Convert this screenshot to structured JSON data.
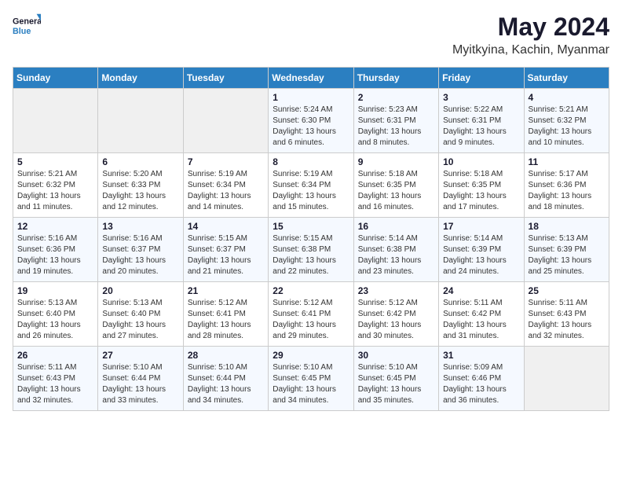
{
  "logo": {
    "line1": "General",
    "line2": "Blue"
  },
  "title": "May 2024",
  "subtitle": "Myitkyina, Kachin, Myanmar",
  "headers": [
    "Sunday",
    "Monday",
    "Tuesday",
    "Wednesday",
    "Thursday",
    "Friday",
    "Saturday"
  ],
  "weeks": [
    [
      {
        "day": "",
        "info": ""
      },
      {
        "day": "",
        "info": ""
      },
      {
        "day": "",
        "info": ""
      },
      {
        "day": "1",
        "info": "Sunrise: 5:24 AM\nSunset: 6:30 PM\nDaylight: 13 hours\nand 6 minutes."
      },
      {
        "day": "2",
        "info": "Sunrise: 5:23 AM\nSunset: 6:31 PM\nDaylight: 13 hours\nand 8 minutes."
      },
      {
        "day": "3",
        "info": "Sunrise: 5:22 AM\nSunset: 6:31 PM\nDaylight: 13 hours\nand 9 minutes."
      },
      {
        "day": "4",
        "info": "Sunrise: 5:21 AM\nSunset: 6:32 PM\nDaylight: 13 hours\nand 10 minutes."
      }
    ],
    [
      {
        "day": "5",
        "info": "Sunrise: 5:21 AM\nSunset: 6:32 PM\nDaylight: 13 hours\nand 11 minutes."
      },
      {
        "day": "6",
        "info": "Sunrise: 5:20 AM\nSunset: 6:33 PM\nDaylight: 13 hours\nand 12 minutes."
      },
      {
        "day": "7",
        "info": "Sunrise: 5:19 AM\nSunset: 6:34 PM\nDaylight: 13 hours\nand 14 minutes."
      },
      {
        "day": "8",
        "info": "Sunrise: 5:19 AM\nSunset: 6:34 PM\nDaylight: 13 hours\nand 15 minutes."
      },
      {
        "day": "9",
        "info": "Sunrise: 5:18 AM\nSunset: 6:35 PM\nDaylight: 13 hours\nand 16 minutes."
      },
      {
        "day": "10",
        "info": "Sunrise: 5:18 AM\nSunset: 6:35 PM\nDaylight: 13 hours\nand 17 minutes."
      },
      {
        "day": "11",
        "info": "Sunrise: 5:17 AM\nSunset: 6:36 PM\nDaylight: 13 hours\nand 18 minutes."
      }
    ],
    [
      {
        "day": "12",
        "info": "Sunrise: 5:16 AM\nSunset: 6:36 PM\nDaylight: 13 hours\nand 19 minutes."
      },
      {
        "day": "13",
        "info": "Sunrise: 5:16 AM\nSunset: 6:37 PM\nDaylight: 13 hours\nand 20 minutes."
      },
      {
        "day": "14",
        "info": "Sunrise: 5:15 AM\nSunset: 6:37 PM\nDaylight: 13 hours\nand 21 minutes."
      },
      {
        "day": "15",
        "info": "Sunrise: 5:15 AM\nSunset: 6:38 PM\nDaylight: 13 hours\nand 22 minutes."
      },
      {
        "day": "16",
        "info": "Sunrise: 5:14 AM\nSunset: 6:38 PM\nDaylight: 13 hours\nand 23 minutes."
      },
      {
        "day": "17",
        "info": "Sunrise: 5:14 AM\nSunset: 6:39 PM\nDaylight: 13 hours\nand 24 minutes."
      },
      {
        "day": "18",
        "info": "Sunrise: 5:13 AM\nSunset: 6:39 PM\nDaylight: 13 hours\nand 25 minutes."
      }
    ],
    [
      {
        "day": "19",
        "info": "Sunrise: 5:13 AM\nSunset: 6:40 PM\nDaylight: 13 hours\nand 26 minutes."
      },
      {
        "day": "20",
        "info": "Sunrise: 5:13 AM\nSunset: 6:40 PM\nDaylight: 13 hours\nand 27 minutes."
      },
      {
        "day": "21",
        "info": "Sunrise: 5:12 AM\nSunset: 6:41 PM\nDaylight: 13 hours\nand 28 minutes."
      },
      {
        "day": "22",
        "info": "Sunrise: 5:12 AM\nSunset: 6:41 PM\nDaylight: 13 hours\nand 29 minutes."
      },
      {
        "day": "23",
        "info": "Sunrise: 5:12 AM\nSunset: 6:42 PM\nDaylight: 13 hours\nand 30 minutes."
      },
      {
        "day": "24",
        "info": "Sunrise: 5:11 AM\nSunset: 6:42 PM\nDaylight: 13 hours\nand 31 minutes."
      },
      {
        "day": "25",
        "info": "Sunrise: 5:11 AM\nSunset: 6:43 PM\nDaylight: 13 hours\nand 32 minutes."
      }
    ],
    [
      {
        "day": "26",
        "info": "Sunrise: 5:11 AM\nSunset: 6:43 PM\nDaylight: 13 hours\nand 32 minutes."
      },
      {
        "day": "27",
        "info": "Sunrise: 5:10 AM\nSunset: 6:44 PM\nDaylight: 13 hours\nand 33 minutes."
      },
      {
        "day": "28",
        "info": "Sunrise: 5:10 AM\nSunset: 6:44 PM\nDaylight: 13 hours\nand 34 minutes."
      },
      {
        "day": "29",
        "info": "Sunrise: 5:10 AM\nSunset: 6:45 PM\nDaylight: 13 hours\nand 34 minutes."
      },
      {
        "day": "30",
        "info": "Sunrise: 5:10 AM\nSunset: 6:45 PM\nDaylight: 13 hours\nand 35 minutes."
      },
      {
        "day": "31",
        "info": "Sunrise: 5:09 AM\nSunset: 6:46 PM\nDaylight: 13 hours\nand 36 minutes."
      },
      {
        "day": "",
        "info": ""
      }
    ]
  ]
}
